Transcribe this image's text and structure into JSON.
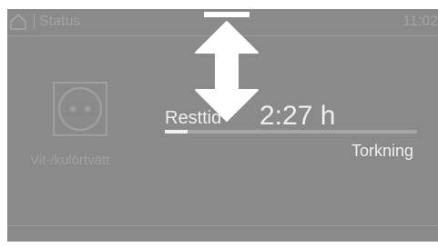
{
  "statusbar": {
    "home_icon": "home-icon",
    "title": "Status",
    "clock": "11:02"
  },
  "program": {
    "icon": "cotton-socket-icon",
    "name": "Vit-/kulörtvätt"
  },
  "progress": {
    "label": "Resttid",
    "time": "2:27 h",
    "fraction": 0.09,
    "phase": "Torkning"
  },
  "overlay": {
    "icon": "vertical-double-arrow-icon"
  },
  "colors": {
    "screen_background": "#8a8a8a",
    "text_bright": "#efefef",
    "text_dim": "#a3a3a3",
    "progress_track": "#a7a7a7",
    "progress_fill": "#f2f2f2"
  }
}
